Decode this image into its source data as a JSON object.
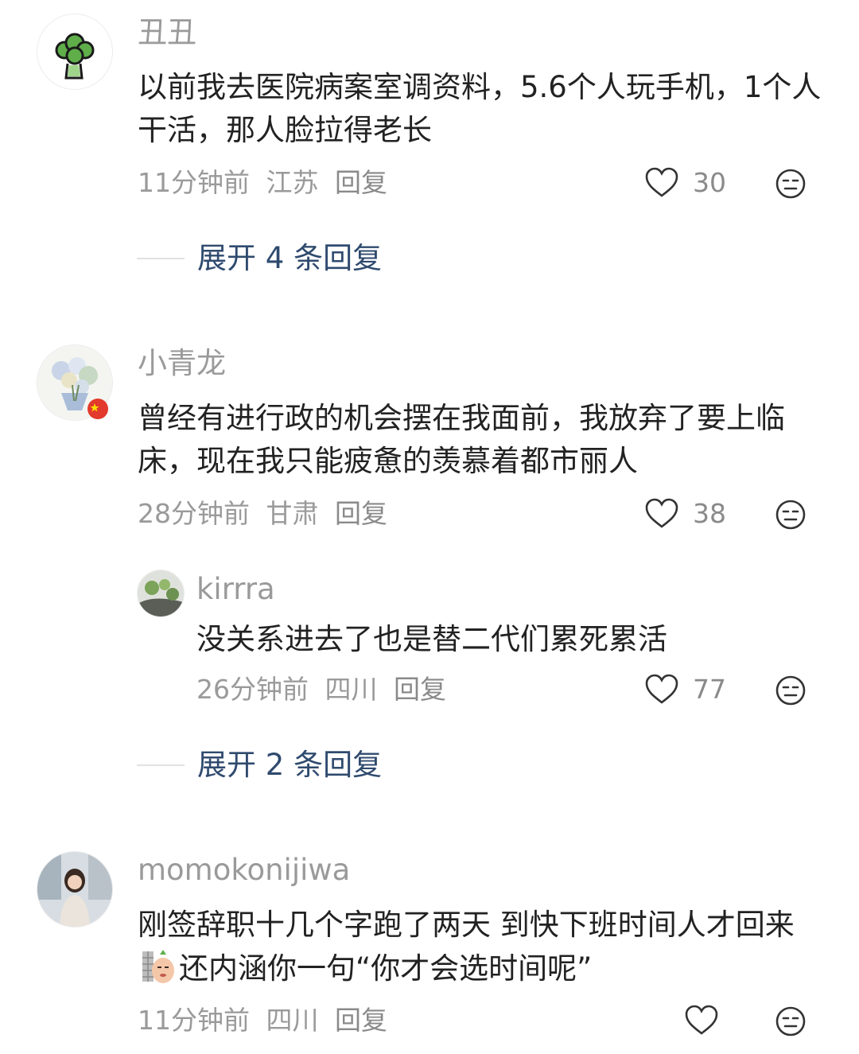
{
  "comments": [
    {
      "username": "丑丑",
      "text": "以前我去医院病案室调资料，5.6个人玩手机，1个人干活，那人脸拉得老长",
      "time": "11分钟前",
      "location": "江苏",
      "reply_label": "回复",
      "likes": "30",
      "expand_label": "展开 4 条回复"
    },
    {
      "username": "小青龙",
      "text": "曾经有进行政的机会摆在我面前，我放弃了要上临床，现在我只能疲惫的羡慕着都市丽人",
      "time": "28分钟前",
      "location": "甘肃",
      "reply_label": "回复",
      "likes": "38",
      "expand_label": "展开 2 条回复",
      "reply": {
        "username": "kirrra",
        "text": "没关系进去了也是替二代们累死累活",
        "time": "26分钟前",
        "location": "四川",
        "reply_label": "回复",
        "likes": "77"
      }
    },
    {
      "username": "momokonijiwa",
      "text_part1": "刚签辞职十几个字跑了两天 到快下班时间人才回来",
      "text_part2": "还内涵你一句“你才会选时间呢”",
      "time": "11分钟前",
      "location": "四川",
      "reply_label": "回复",
      "likes": ""
    }
  ],
  "colors": {
    "username": "#9a9a9a",
    "body": "#222222",
    "meta": "#9a9a9a",
    "expand": "#2f4a6e"
  },
  "icons": [
    "broccoli-avatar",
    "bouquet-avatar",
    "china-flag-badge",
    "moss-avatar",
    "girl-avatar",
    "heart-icon",
    "dislike-face-icon",
    "sticker-emoji"
  ]
}
